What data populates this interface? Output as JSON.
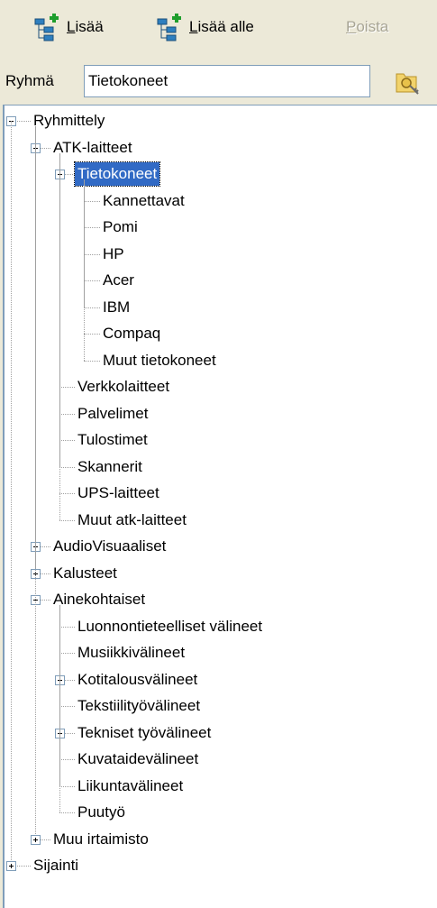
{
  "toolbar": {
    "add": {
      "label": "Lisää",
      "underline": "L",
      "rest": "isää"
    },
    "add_below": {
      "label": "Lisää alle",
      "underline": "L",
      "rest": "isää alle"
    },
    "delete": {
      "label": "Poista",
      "underline": "P",
      "rest": "oista"
    }
  },
  "group": {
    "label": "Ryhmä",
    "value": "Tietokoneet"
  },
  "tree": [
    {
      "text": "Ryhmittely",
      "level": 0,
      "expander": "minus"
    },
    {
      "text": "ATK-laitteet",
      "level": 1,
      "expander": "minus"
    },
    {
      "text": "Tietokoneet",
      "level": 2,
      "expander": "minus",
      "selected": true
    },
    {
      "text": "Kannettavat",
      "level": 3
    },
    {
      "text": "Pomi",
      "level": 3
    },
    {
      "text": "HP",
      "level": 3
    },
    {
      "text": "Acer",
      "level": 3
    },
    {
      "text": "IBM",
      "level": 3
    },
    {
      "text": "Compaq",
      "level": 3
    },
    {
      "text": "Muut tietokoneet",
      "level": 3,
      "last": true
    },
    {
      "text": "Verkkolaitteet",
      "level": 2
    },
    {
      "text": "Palvelimet",
      "level": 2
    },
    {
      "text": "Tulostimet",
      "level": 2
    },
    {
      "text": "Skannerit",
      "level": 2
    },
    {
      "text": "UPS-laitteet",
      "level": 2
    },
    {
      "text": "Muut atk-laitteet",
      "level": 2,
      "last": true
    },
    {
      "text": "AudioVisuaaliset",
      "level": 1,
      "expander": "plus"
    },
    {
      "text": "Kalusteet",
      "level": 1,
      "expander": "plus"
    },
    {
      "text": "Ainekohtaiset",
      "level": 1,
      "expander": "minus"
    },
    {
      "text": "Luonnontieteelliset välineet",
      "level": 2
    },
    {
      "text": "Musiikkivälineet",
      "level": 2
    },
    {
      "text": "Kotitalousvälineet",
      "level": 2,
      "expander": "plus"
    },
    {
      "text": "Tekstiilityövälineet",
      "level": 2
    },
    {
      "text": "Tekniset työvälineet",
      "level": 2,
      "expander": "plus"
    },
    {
      "text": "Kuvataidevälineet",
      "level": 2
    },
    {
      "text": "Liikuntavälineet",
      "level": 2
    },
    {
      "text": "Puutyö",
      "level": 2,
      "last": true
    },
    {
      "text": "Muu irtaimisto",
      "level": 1,
      "expander": "plus",
      "last": true
    },
    {
      "text": "Sijainti",
      "level": 0,
      "expander": "plus"
    }
  ],
  "colors": {
    "selection": "#316AC5",
    "window": "#ECE9D8",
    "border": "#7F9DB9"
  },
  "icons": {
    "add": "tree-add-icon",
    "add_below": "tree-add-child-icon",
    "group_key": "key-folder-icon"
  }
}
